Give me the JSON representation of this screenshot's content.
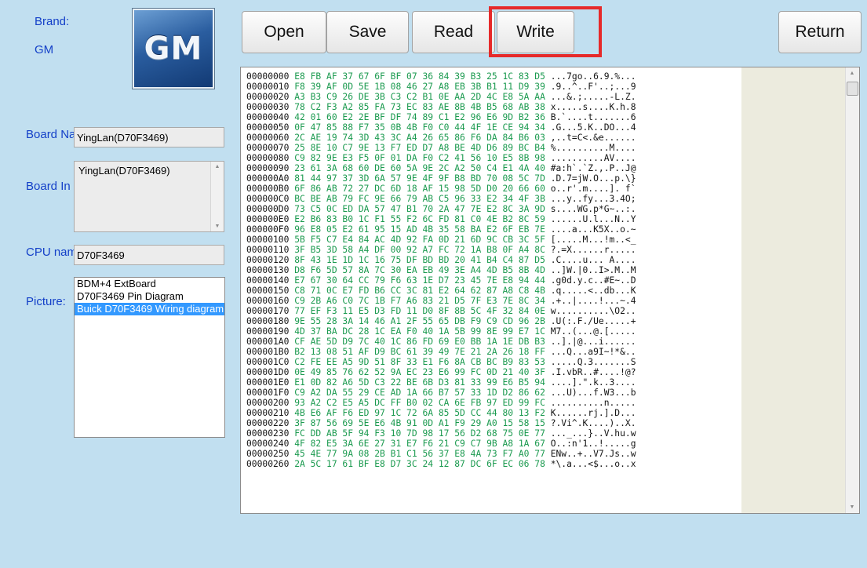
{
  "brand_label": "Brand:",
  "brand_value": "GM",
  "logo_text": "GM",
  "fields": {
    "board_name": {
      "label": "Board Na",
      "value": "YingLan(D70F3469)"
    },
    "board_info": {
      "label": "Board In",
      "value": "YingLan(D70F3469)"
    },
    "cpu_name": {
      "label": "CPU nam",
      "value": "D70F3469"
    },
    "picture": {
      "label": "Picture:",
      "items": [
        "BDM+4 ExtBoard",
        "D70F3469 Pin Diagram",
        "Buick D70F3469 Wiring diagram"
      ],
      "selected_index": 2
    }
  },
  "toolbar": {
    "open": "Open",
    "save": "Save",
    "read": "Read",
    "write": "Write",
    "return": "Return"
  },
  "colors": {
    "hex_bytes": "#1b9a4f",
    "highlight": "#e62a2a",
    "label": "#1440c8",
    "selection": "#3399ff"
  },
  "hex_rows": [
    {
      "o": "00000000",
      "h": "E8 FB AF 37 67 6F BF 07 36 84 39 B3 25 1C 83 D5",
      "a": "...7go..6.9.%..."
    },
    {
      "o": "00000010",
      "h": "F8 39 AF 0D 5E 1B 08 46 27 A8 EB 3B B1 11 D9 39",
      "a": ".9..^..F'..;...9"
    },
    {
      "o": "00000020",
      "h": "A3 B3 C9 26 DE 3B C3 C2 B1 0E AA 2D 4C E8 5A AA",
      "a": "...&.;.....-L.Z."
    },
    {
      "o": "00000030",
      "h": "78 C2 F3 A2 85 FA 73 EC 83 AE 8B 4B B5 68 AB 38",
      "a": "x.....s....K.h.8"
    },
    {
      "o": "00000040",
      "h": "42 01 60 E2 2E BF DF 74 89 C1 E2 96 E6 9D B2 36",
      "a": "B.`....t.......6"
    },
    {
      "o": "00000050",
      "h": "0F 47 85 88 F7 35 0B 4B F0 C0 44 4F 1E CE 94 34",
      "a": ".G...5.K..DO...4"
    },
    {
      "o": "00000060",
      "h": "2C AE 19 74 3D 43 3C A4 26 65 86 F6 DA 84 B6 03",
      "a": ",..t=C<.&e......"
    },
    {
      "o": "00000070",
      "h": "25 8E 10 C7 9E 13 F7 ED D7 A8 BE 4D D6 89 BC B4",
      "a": "%..........M...."
    },
    {
      "o": "00000080",
      "h": "C9 82 9E E3 F5 0F 01 DA F0 C2 41 56 10 E5 8B 98",
      "a": "..........AV...."
    },
    {
      "o": "00000090",
      "h": "23 61 3A 68 60 DE 60 5A 9E 2C A2 50 C4 E1 4A 40",
      "a": "#a:h`.`Z.,.P..J@"
    },
    {
      "o": "000000A0",
      "h": "81 44 97 37 3D 6A 57 9E 4F 9F B8 BD 70 08 5C 7D",
      "a": ".D.7=jW.O...p.\\}"
    },
    {
      "o": "000000B0",
      "h": "6F 86 AB 72 27 DC 6D 18 AF 15 98 5D D0 20 66 60",
      "a": "o..r'.m....]. f`"
    },
    {
      "o": "000000C0",
      "h": "BC BE AB 79 FC 9E 66 79 AB C5 96 33 E2 34 4F 3B",
      "a": "...y..fy...3.4O;"
    },
    {
      "o": "000000D0",
      "h": "73 C5 0C ED DA 57 47 B1 70 2A 47 7E E2 8C 3A 9D",
      "a": "s....WG.p*G~..:."
    },
    {
      "o": "000000E0",
      "h": "E2 B6 83 B0 1C F1 55 F2 6C FD 81 C0 4E B2 8C 59",
      "a": "......U.l...N..Y"
    },
    {
      "o": "000000F0",
      "h": "96 E8 05 E2 61 95 15 AD 4B 35 58 BA E2 6F EB 7E",
      "a": "....a...K5X..o.~"
    },
    {
      "o": "00000100",
      "h": "5B F5 C7 E4 84 AC 4D 92 FA 0D 21 6D 9C CB 3C 5F",
      "a": "[.....M...!m..<_"
    },
    {
      "o": "00000110",
      "h": "3F B5 3D 58 A4 DF 00 92 A7 FC 72 1A B8 0F A4 8C",
      "a": "?.=X......r....."
    },
    {
      "o": "00000120",
      "h": "8F 43 1E 1D 1C 16 75 DF BD BD 20 41 B4 C4 87 D5",
      "a": ".C....u... A...."
    },
    {
      "o": "00000130",
      "h": "D8 F6 5D 57 8A 7C 30 EA EB 49 3E A4 4D B5 8B 4D",
      "a": "..]W.|0..I>.M..M"
    },
    {
      "o": "00000140",
      "h": "E7 67 30 64 CC 79 F6 63 1E D7 23 45 7E E8 94 44",
      "a": ".g0d.y.c..#E~..D"
    },
    {
      "o": "00000150",
      "h": "C8 71 0C E7 FD B6 CC 3C 81 E2 64 62 87 A8 C8 4B",
      "a": ".q.....<..db...K"
    },
    {
      "o": "00000160",
      "h": "C9 2B A6 C0 7C 1B F7 A6 83 21 D5 7F E3 7E 8C 34",
      "a": ".+..|....!...~.4"
    },
    {
      "o": "00000170",
      "h": "77 EF F3 11 E5 D3 FD 11 D0 8F 8B 5C 4F 32 84 0E",
      "a": "w..........\\O2.."
    },
    {
      "o": "00000180",
      "h": "9E 55 28 3A 14 46 A1 2F 55 65 DB F9 C9 CD 96 2B",
      "a": ".U(:.F./Ue.....+"
    },
    {
      "o": "00000190",
      "h": "4D 37 BA DC 28 1C EA F0 40 1A 5B 99 8E 99 E7 1C",
      "a": "M7..(...@.[....."
    },
    {
      "o": "000001A0",
      "h": "CF AE 5D D9 7C 40 1C 86 FD 69 E0 BB 1A 1E DB B3",
      "a": "..].|@...i......"
    },
    {
      "o": "000001B0",
      "h": "B2 13 08 51 AF D9 BC 61 39 49 7E 21 2A 26 18 FF",
      "a": "...Q...a9I~!*&.."
    },
    {
      "o": "000001C0",
      "h": "C2 FE EE A5 9D 51 8F 33 E1 F6 8A CB BC B9 83 53",
      "a": ".....Q.3.......S"
    },
    {
      "o": "000001D0",
      "h": "0E 49 85 76 62 52 9A EC 23 E6 99 FC 0D 21 40 3F",
      "a": ".I.vbR..#....!@?"
    },
    {
      "o": "000001E0",
      "h": "E1 0D 82 A6 5D C3 22 BE 6B D3 81 33 99 E6 B5 94",
      "a": "....].\".k..3...."
    },
    {
      "o": "000001F0",
      "h": "C9 A2 DA 55 29 CE AD 1A 66 B7 57 33 1D D2 86 62",
      "a": "...U)...f.W3...b"
    },
    {
      "o": "00000200",
      "h": "93 A2 C2 E5 A5 DC FF B0 02 CA 6E FB 97 ED 99 FC",
      "a": "..........n....."
    },
    {
      "o": "00000210",
      "h": "4B E6 AF F6 ED 97 1C 72 6A 85 5D CC 44 80 13 F2",
      "a": "K......rj.].D..."
    },
    {
      "o": "00000220",
      "h": "3F 87 56 69 5E E6 4B 91 0D A1 F9 29 A0 15 58 15",
      "a": "?.Vi^.K....)..X."
    },
    {
      "o": "00000230",
      "h": "FC DD AB 5F 94 F3 10 7D 98 17 56 D2 68 75 0E 77",
      "a": "..._...}..V.hu.w"
    },
    {
      "o": "00000240",
      "h": "4F 82 E5 3A 6E 27 31 E7 F6 21 C9 C7 9B A8 1A 67",
      "a": "O..:n'1..!.....g"
    },
    {
      "o": "00000250",
      "h": "45 4E 77 9A 08 2B B1 C1 56 37 E8 4A 73 F7 A0 77",
      "a": "ENw..+..V7.Js..w"
    },
    {
      "o": "00000260",
      "h": "2A 5C 17 61 BF E8 D7 3C 24 12 87 DC 6F EC 06 78",
      "a": "*\\.a...<$...o..x"
    }
  ]
}
